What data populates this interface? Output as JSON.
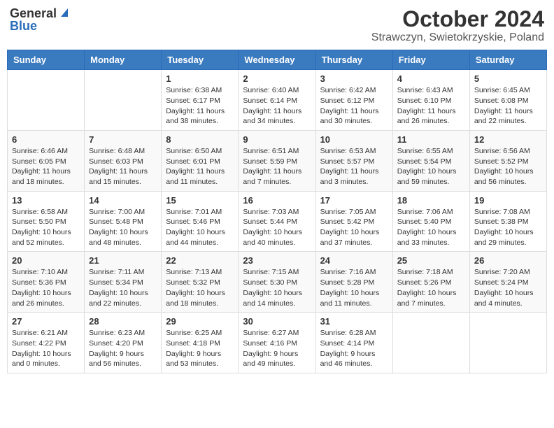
{
  "logo": {
    "general": "General",
    "blue": "Blue"
  },
  "header": {
    "month": "October 2024",
    "location": "Strawczyn, Swietokrzyskie, Poland"
  },
  "weekdays": [
    "Sunday",
    "Monday",
    "Tuesday",
    "Wednesday",
    "Thursday",
    "Friday",
    "Saturday"
  ],
  "weeks": [
    [
      {
        "day": "",
        "info": ""
      },
      {
        "day": "",
        "info": ""
      },
      {
        "day": "1",
        "info": "Sunrise: 6:38 AM\nSunset: 6:17 PM\nDaylight: 11 hours and 38 minutes."
      },
      {
        "day": "2",
        "info": "Sunrise: 6:40 AM\nSunset: 6:14 PM\nDaylight: 11 hours and 34 minutes."
      },
      {
        "day": "3",
        "info": "Sunrise: 6:42 AM\nSunset: 6:12 PM\nDaylight: 11 hours and 30 minutes."
      },
      {
        "day": "4",
        "info": "Sunrise: 6:43 AM\nSunset: 6:10 PM\nDaylight: 11 hours and 26 minutes."
      },
      {
        "day": "5",
        "info": "Sunrise: 6:45 AM\nSunset: 6:08 PM\nDaylight: 11 hours and 22 minutes."
      }
    ],
    [
      {
        "day": "6",
        "info": "Sunrise: 6:46 AM\nSunset: 6:05 PM\nDaylight: 11 hours and 18 minutes."
      },
      {
        "day": "7",
        "info": "Sunrise: 6:48 AM\nSunset: 6:03 PM\nDaylight: 11 hours and 15 minutes."
      },
      {
        "day": "8",
        "info": "Sunrise: 6:50 AM\nSunset: 6:01 PM\nDaylight: 11 hours and 11 minutes."
      },
      {
        "day": "9",
        "info": "Sunrise: 6:51 AM\nSunset: 5:59 PM\nDaylight: 11 hours and 7 minutes."
      },
      {
        "day": "10",
        "info": "Sunrise: 6:53 AM\nSunset: 5:57 PM\nDaylight: 11 hours and 3 minutes."
      },
      {
        "day": "11",
        "info": "Sunrise: 6:55 AM\nSunset: 5:54 PM\nDaylight: 10 hours and 59 minutes."
      },
      {
        "day": "12",
        "info": "Sunrise: 6:56 AM\nSunset: 5:52 PM\nDaylight: 10 hours and 56 minutes."
      }
    ],
    [
      {
        "day": "13",
        "info": "Sunrise: 6:58 AM\nSunset: 5:50 PM\nDaylight: 10 hours and 52 minutes."
      },
      {
        "day": "14",
        "info": "Sunrise: 7:00 AM\nSunset: 5:48 PM\nDaylight: 10 hours and 48 minutes."
      },
      {
        "day": "15",
        "info": "Sunrise: 7:01 AM\nSunset: 5:46 PM\nDaylight: 10 hours and 44 minutes."
      },
      {
        "day": "16",
        "info": "Sunrise: 7:03 AM\nSunset: 5:44 PM\nDaylight: 10 hours and 40 minutes."
      },
      {
        "day": "17",
        "info": "Sunrise: 7:05 AM\nSunset: 5:42 PM\nDaylight: 10 hours and 37 minutes."
      },
      {
        "day": "18",
        "info": "Sunrise: 7:06 AM\nSunset: 5:40 PM\nDaylight: 10 hours and 33 minutes."
      },
      {
        "day": "19",
        "info": "Sunrise: 7:08 AM\nSunset: 5:38 PM\nDaylight: 10 hours and 29 minutes."
      }
    ],
    [
      {
        "day": "20",
        "info": "Sunrise: 7:10 AM\nSunset: 5:36 PM\nDaylight: 10 hours and 26 minutes."
      },
      {
        "day": "21",
        "info": "Sunrise: 7:11 AM\nSunset: 5:34 PM\nDaylight: 10 hours and 22 minutes."
      },
      {
        "day": "22",
        "info": "Sunrise: 7:13 AM\nSunset: 5:32 PM\nDaylight: 10 hours and 18 minutes."
      },
      {
        "day": "23",
        "info": "Sunrise: 7:15 AM\nSunset: 5:30 PM\nDaylight: 10 hours and 14 minutes."
      },
      {
        "day": "24",
        "info": "Sunrise: 7:16 AM\nSunset: 5:28 PM\nDaylight: 10 hours and 11 minutes."
      },
      {
        "day": "25",
        "info": "Sunrise: 7:18 AM\nSunset: 5:26 PM\nDaylight: 10 hours and 7 minutes."
      },
      {
        "day": "26",
        "info": "Sunrise: 7:20 AM\nSunset: 5:24 PM\nDaylight: 10 hours and 4 minutes."
      }
    ],
    [
      {
        "day": "27",
        "info": "Sunrise: 6:21 AM\nSunset: 4:22 PM\nDaylight: 10 hours and 0 minutes."
      },
      {
        "day": "28",
        "info": "Sunrise: 6:23 AM\nSunset: 4:20 PM\nDaylight: 9 hours and 56 minutes."
      },
      {
        "day": "29",
        "info": "Sunrise: 6:25 AM\nSunset: 4:18 PM\nDaylight: 9 hours and 53 minutes."
      },
      {
        "day": "30",
        "info": "Sunrise: 6:27 AM\nSunset: 4:16 PM\nDaylight: 9 hours and 49 minutes."
      },
      {
        "day": "31",
        "info": "Sunrise: 6:28 AM\nSunset: 4:14 PM\nDaylight: 9 hours and 46 minutes."
      },
      {
        "day": "",
        "info": ""
      },
      {
        "day": "",
        "info": ""
      }
    ]
  ]
}
